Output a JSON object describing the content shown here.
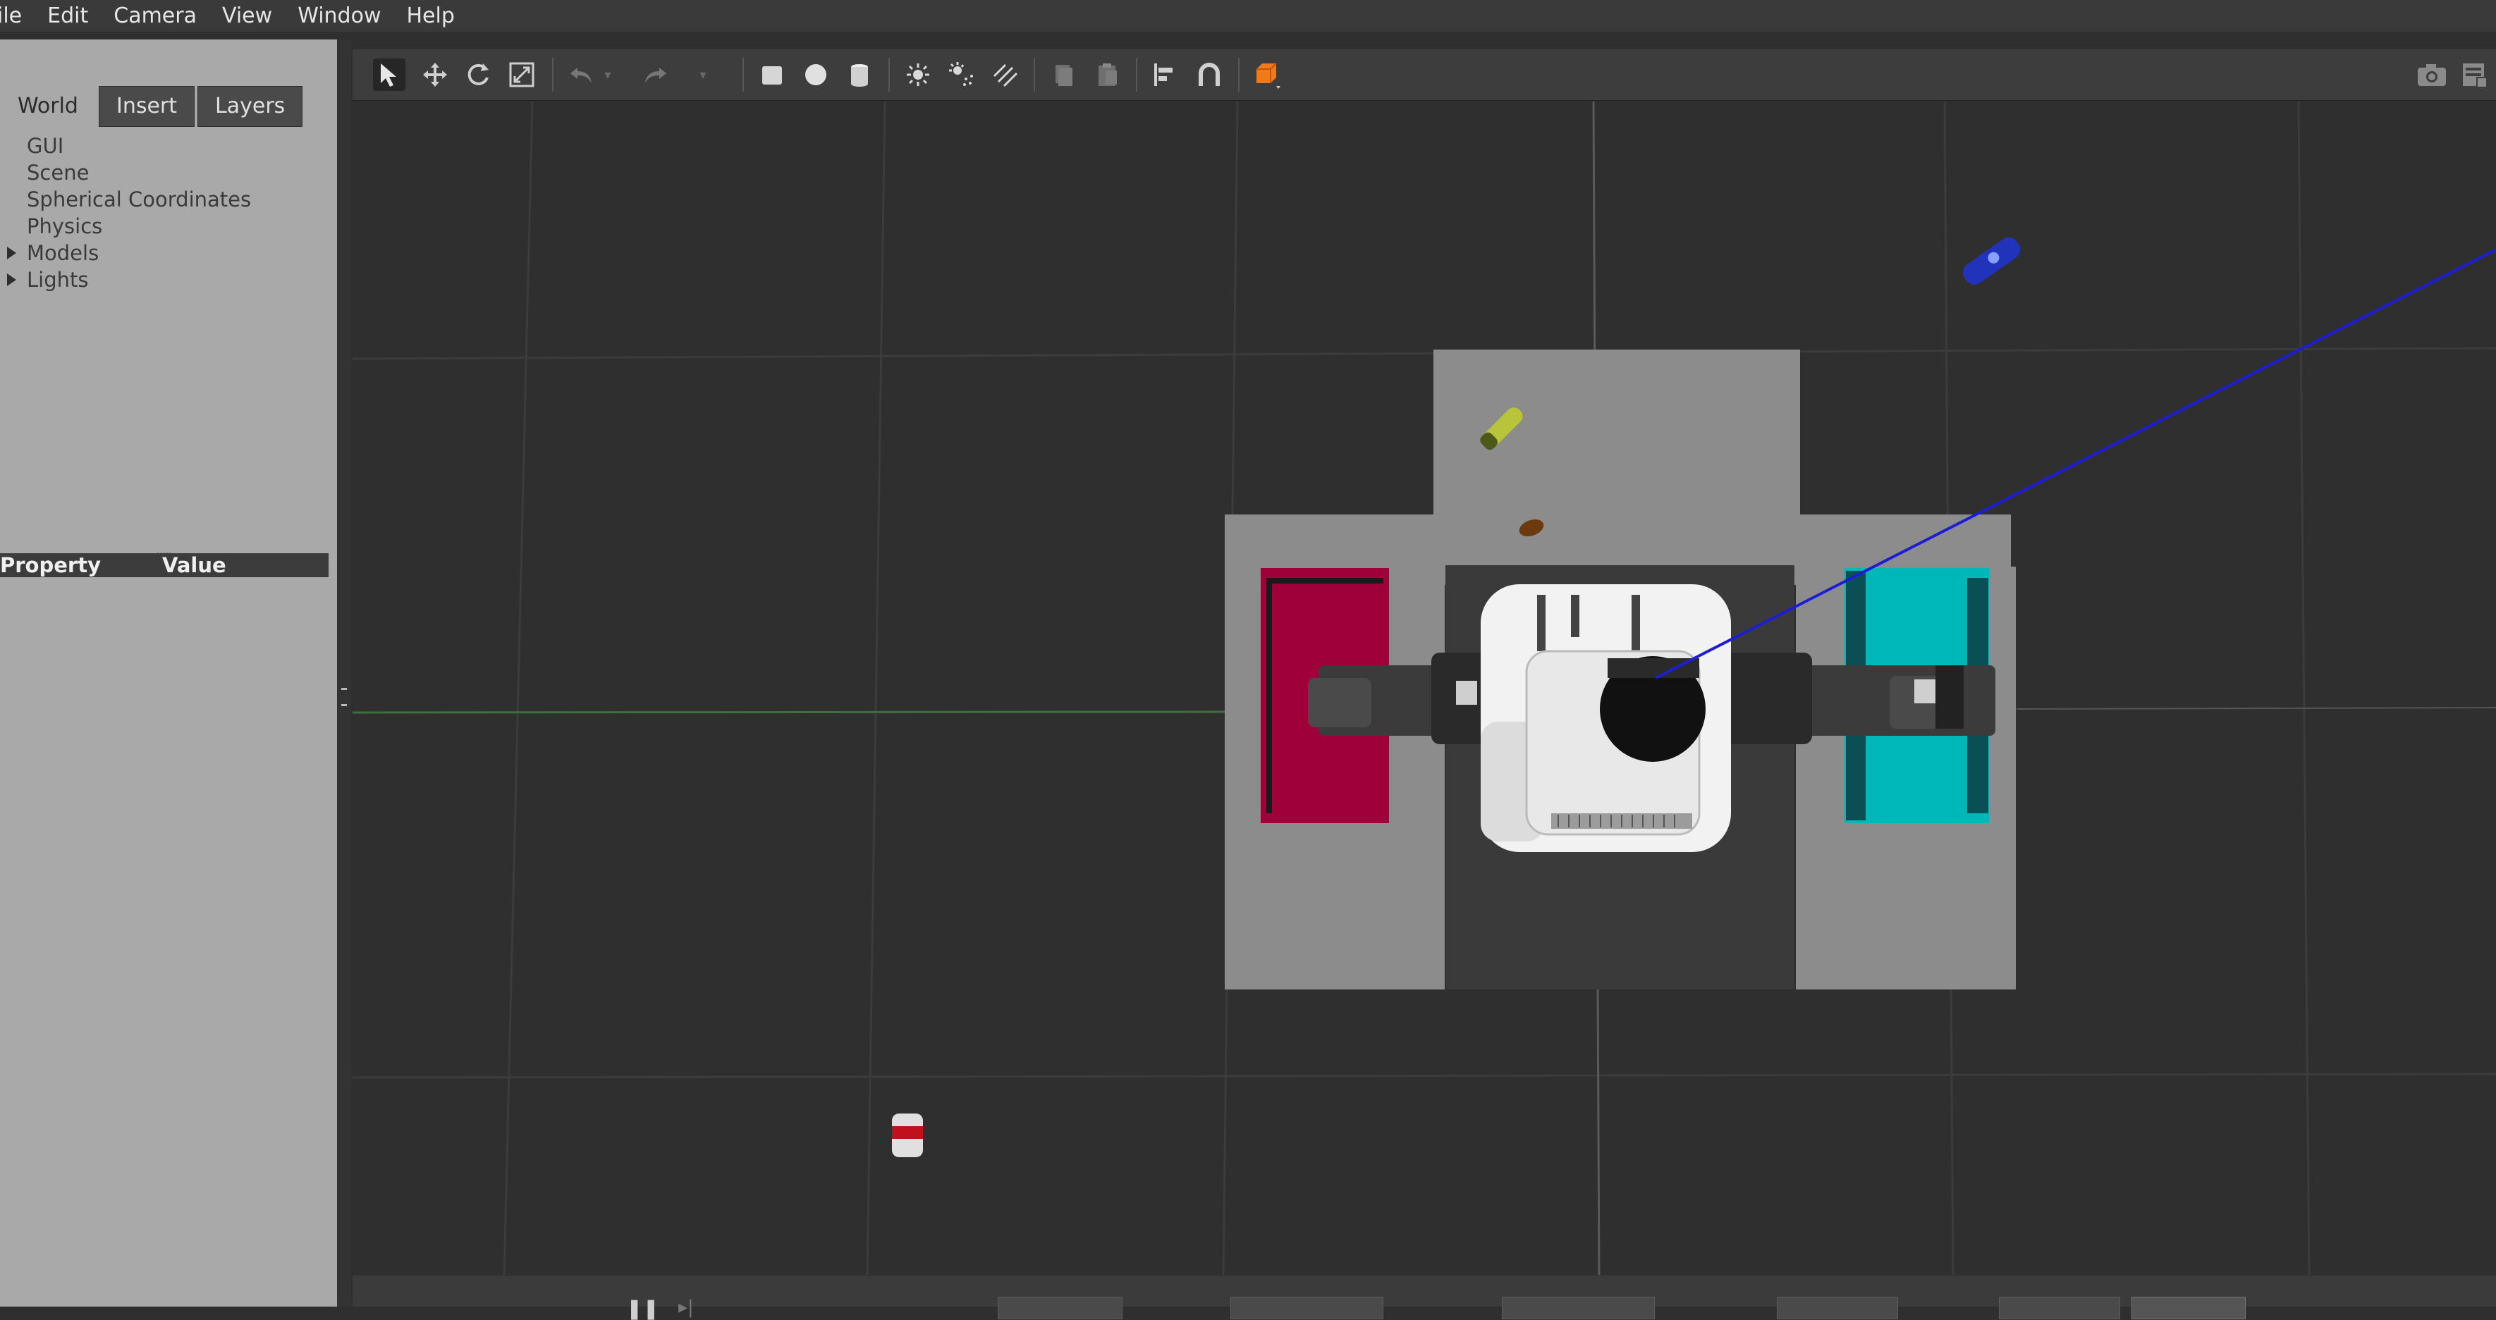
{
  "menu": [
    "ile",
    "Edit",
    "Camera",
    "View",
    "Window",
    "Help"
  ],
  "left_panel": {
    "tabs": [
      "World",
      "Insert",
      "Layers"
    ],
    "tree": [
      {
        "label": "GUI",
        "expandable": false
      },
      {
        "label": "Scene",
        "expandable": false
      },
      {
        "label": "Spherical Coordinates",
        "expandable": false
      },
      {
        "label": "Physics",
        "expandable": false
      },
      {
        "label": "Models",
        "expandable": true
      },
      {
        "label": "Lights",
        "expandable": true
      }
    ],
    "property_header": {
      "property": "Property",
      "value": "Value"
    }
  },
  "toolbar": {
    "icons": [
      "select-arrow-icon",
      "translate-icon",
      "rotate-icon",
      "scale-icon",
      "undo-icon",
      "undo-dropdown-icon",
      "redo-icon",
      "redo-dropdown-icon",
      "box-shape-icon",
      "sphere-shape-icon",
      "cylinder-shape-icon",
      "point-light-icon",
      "spot-light-icon",
      "directional-light-icon",
      "copy-icon",
      "paste-icon",
      "align-icon",
      "magnet-snap-icon",
      "view-angle-icon"
    ],
    "right_icons": [
      "screenshot-camera-icon",
      "log-icon"
    ]
  },
  "scene": {
    "objects": [
      "red-bin",
      "teal-bin",
      "pr2-robot",
      "blue-object",
      "yellow-object",
      "brown-object",
      "soda-can"
    ],
    "colors": {
      "red_bin": "#a0003a",
      "teal_bin": "#00b7b7",
      "table": "#8c8c8c",
      "grid": "#3a3a3a",
      "ray": "#1d1dd6"
    }
  },
  "statusbar": {
    "visible": true
  }
}
